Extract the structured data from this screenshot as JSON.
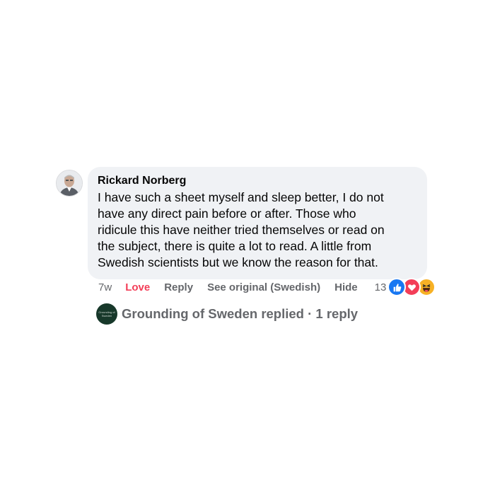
{
  "comment": {
    "author": "Rickard Norberg",
    "text_lines": [
      "I have such a sheet myself and sleep better, I do not",
      "have any direct pain before or after. Those who",
      "ridicule this have neither tried themselves or read on",
      "the subject, there is quite a lot to read. A little from",
      "Swedish scientists but we know the reason for that."
    ],
    "timestamp": "7w",
    "actions": {
      "love": "Love",
      "reply": "Reply",
      "see_original": "See original (Swedish)",
      "hide": "Hide"
    },
    "reactions": {
      "count": "13",
      "icons": [
        "like-icon",
        "love-icon",
        "haha-icon"
      ]
    },
    "colors": {
      "bubble_bg": "#f0f2f5",
      "love_accent": "#f33e58",
      "secondary_text": "#65676b",
      "like_blue": "#1877f2"
    }
  },
  "replies": {
    "avatar_text": "Grounding of Sweden",
    "summary": "Grounding of Sweden replied · 1 reply"
  }
}
